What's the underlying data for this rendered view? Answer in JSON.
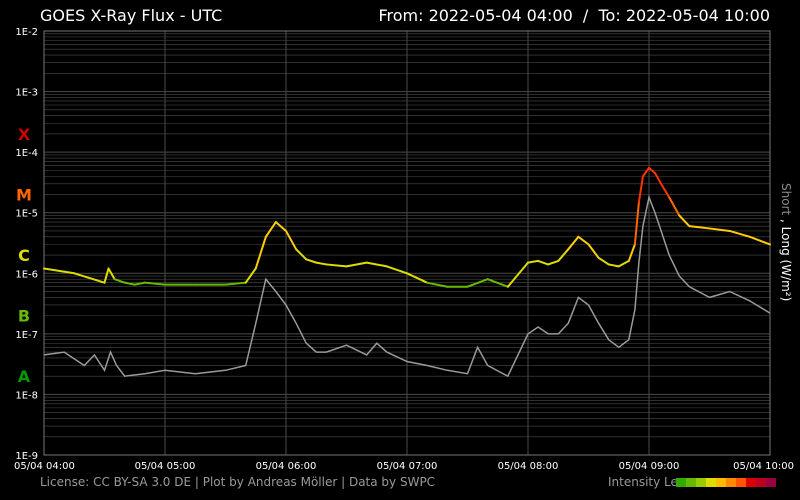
{
  "header": {
    "title": "GOES X-Ray Flux - UTC",
    "from_label": "From:",
    "from_value": "2022-05-04 04:00",
    "to_label": "To:",
    "to_value": "2022-05-04 10:00"
  },
  "footer": {
    "credits": "License: CC BY-SA 3.0 DE | Plot by Andreas Möller | Data by SWPC",
    "legend_label": "Intensity Legend"
  },
  "colors": {
    "background": "#000000",
    "grid": "#4a4a4a",
    "short_series": "#9a9a9a",
    "class_X": "#cc0000",
    "class_M": "#ff6600",
    "class_C": "#dddd00",
    "class_B": "#66bb00",
    "class_A": "#009900",
    "intensity_scale": [
      "#33aa00",
      "#66bb00",
      "#99cc00",
      "#dddd00",
      "#ffbb00",
      "#ff8800",
      "#ff5500",
      "#dd0000",
      "#bb0022",
      "#990044"
    ]
  },
  "chart_data": {
    "type": "line",
    "title": "GOES X-Ray Flux - UTC",
    "ylabel_parts": [
      "Short",
      ",",
      "Long (W/m²)"
    ],
    "y_scale": "log",
    "ylim": [
      1e-09,
      0.01
    ],
    "y_tick_labels": [
      "1E-2",
      "1E-3",
      "1E-4",
      "1E-5",
      "1E-6",
      "1E-7",
      "1E-8",
      "1E-9"
    ],
    "y_tick_values": [
      0.01,
      0.001,
      0.0001,
      1e-05,
      1e-06,
      1e-07,
      1e-08,
      1e-09
    ],
    "flare_classes": [
      {
        "label": "X",
        "value": 0.0002
      },
      {
        "label": "M",
        "value": 2e-05
      },
      {
        "label": "C",
        "value": 2e-06
      },
      {
        "label": "B",
        "value": 2e-07
      },
      {
        "label": "A",
        "value": 2e-08
      }
    ],
    "xlim": [
      "2022-05-04 04:00",
      "2022-05-04 10:00"
    ],
    "x_tick_labels": [
      "05/04 04:00",
      "05/04 05:00",
      "05/04 06:00",
      "05/04 07:00",
      "05/04 08:00",
      "05/04 09:00",
      "05/04 10:00"
    ],
    "x_tick_values": [
      "2022-05-04 04:00",
      "2022-05-04 05:00",
      "2022-05-04 06:00",
      "2022-05-04 07:00",
      "2022-05-04 08:00",
      "2022-05-04 09:00",
      "2022-05-04 10:00"
    ],
    "grid": true,
    "series": [
      {
        "id": "long",
        "x": [
          "2022-05-04 04:00",
          "2022-05-04 04:15",
          "2022-05-04 04:30",
          "2022-05-04 04:32",
          "2022-05-04 04:35",
          "2022-05-04 04:40",
          "2022-05-04 04:45",
          "2022-05-04 04:50",
          "2022-05-04 05:00",
          "2022-05-04 05:15",
          "2022-05-04 05:30",
          "2022-05-04 05:40",
          "2022-05-04 05:45",
          "2022-05-04 05:50",
          "2022-05-04 05:55",
          "2022-05-04 06:00",
          "2022-05-04 06:05",
          "2022-05-04 06:10",
          "2022-05-04 06:15",
          "2022-05-04 06:20",
          "2022-05-04 06:30",
          "2022-05-04 06:40",
          "2022-05-04 06:50",
          "2022-05-04 07:00",
          "2022-05-04 07:10",
          "2022-05-04 07:20",
          "2022-05-04 07:30",
          "2022-05-04 07:40",
          "2022-05-04 07:50",
          "2022-05-04 08:00",
          "2022-05-04 08:05",
          "2022-05-04 08:10",
          "2022-05-04 08:15",
          "2022-05-04 08:20",
          "2022-05-04 08:25",
          "2022-05-04 08:30",
          "2022-05-04 08:35",
          "2022-05-04 08:40",
          "2022-05-04 08:45",
          "2022-05-04 08:50",
          "2022-05-04 08:53",
          "2022-05-04 08:55",
          "2022-05-04 08:57",
          "2022-05-04 09:00",
          "2022-05-04 09:03",
          "2022-05-04 09:06",
          "2022-05-04 09:10",
          "2022-05-04 09:15",
          "2022-05-04 09:20",
          "2022-05-04 09:30",
          "2022-05-04 09:40",
          "2022-05-04 09:50",
          "2022-05-04 10:00"
        ],
        "y": [
          1.2e-06,
          1e-06,
          7e-07,
          1.2e-06,
          8e-07,
          7e-07,
          6.5e-07,
          7e-07,
          6.5e-07,
          6.5e-07,
          6.5e-07,
          7e-07,
          1.2e-06,
          4e-06,
          7e-06,
          5e-06,
          2.5e-06,
          1.7e-06,
          1.5e-06,
          1.4e-06,
          1.3e-06,
          1.5e-06,
          1.3e-06,
          1e-06,
          7e-07,
          6e-07,
          6e-07,
          8e-07,
          6e-07,
          1.5e-06,
          1.6e-06,
          1.4e-06,
          1.6e-06,
          2.5e-06,
          4e-06,
          3e-06,
          1.8e-06,
          1.4e-06,
          1.3e-06,
          1.6e-06,
          3e-06,
          1.5e-05,
          4e-05,
          5.5e-05,
          4.5e-05,
          3e-05,
          1.8e-05,
          9e-06,
          6e-06,
          5.5e-06,
          5e-06,
          4e-06,
          3e-06
        ]
      },
      {
        "id": "short",
        "x": [
          "2022-05-04 04:00",
          "2022-05-04 04:10",
          "2022-05-04 04:20",
          "2022-05-04 04:25",
          "2022-05-04 04:30",
          "2022-05-04 04:33",
          "2022-05-04 04:36",
          "2022-05-04 04:40",
          "2022-05-04 04:50",
          "2022-05-04 05:00",
          "2022-05-04 05:15",
          "2022-05-04 05:30",
          "2022-05-04 05:40",
          "2022-05-04 05:45",
          "2022-05-04 05:50",
          "2022-05-04 05:55",
          "2022-05-04 06:00",
          "2022-05-04 06:05",
          "2022-05-04 06:10",
          "2022-05-04 06:15",
          "2022-05-04 06:20",
          "2022-05-04 06:30",
          "2022-05-04 06:40",
          "2022-05-04 06:45",
          "2022-05-04 06:50",
          "2022-05-04 07:00",
          "2022-05-04 07:10",
          "2022-05-04 07:20",
          "2022-05-04 07:30",
          "2022-05-04 07:35",
          "2022-05-04 07:40",
          "2022-05-04 07:50",
          "2022-05-04 08:00",
          "2022-05-04 08:05",
          "2022-05-04 08:10",
          "2022-05-04 08:15",
          "2022-05-04 08:20",
          "2022-05-04 08:25",
          "2022-05-04 08:30",
          "2022-05-04 08:35",
          "2022-05-04 08:40",
          "2022-05-04 08:45",
          "2022-05-04 08:50",
          "2022-05-04 08:53",
          "2022-05-04 08:55",
          "2022-05-04 08:57",
          "2022-05-04 09:00",
          "2022-05-04 09:03",
          "2022-05-04 09:06",
          "2022-05-04 09:10",
          "2022-05-04 09:15",
          "2022-05-04 09:20",
          "2022-05-04 09:30",
          "2022-05-04 09:40",
          "2022-05-04 09:50",
          "2022-05-04 10:00"
        ],
        "y": [
          4.5e-08,
          5e-08,
          3e-08,
          4.5e-08,
          2.5e-08,
          5e-08,
          3e-08,
          2e-08,
          2.2e-08,
          2.5e-08,
          2.2e-08,
          2.5e-08,
          3e-08,
          1.5e-07,
          8e-07,
          5e-07,
          3e-07,
          1.5e-07,
          7e-08,
          5e-08,
          5e-08,
          6.5e-08,
          4.5e-08,
          7e-08,
          5e-08,
          3.5e-08,
          3e-08,
          2.5e-08,
          2.2e-08,
          6e-08,
          3e-08,
          2e-08,
          1e-07,
          1.3e-07,
          1e-07,
          1e-07,
          1.5e-07,
          4e-07,
          3e-07,
          1.5e-07,
          8e-08,
          6e-08,
          8e-08,
          2.5e-07,
          1.5e-06,
          6e-06,
          1.8e-05,
          1e-05,
          5e-06,
          2e-06,
          9e-07,
          6e-07,
          4e-07,
          5e-07,
          3.5e-07,
          2.2e-07
        ]
      }
    ]
  }
}
